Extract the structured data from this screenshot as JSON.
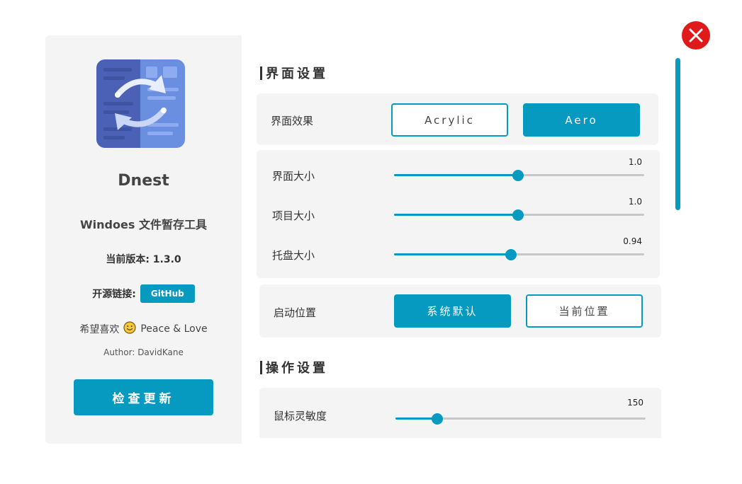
{
  "about": {
    "app_name": "Dnest",
    "subtitle": "Windoes 文件暂存工具",
    "version_line": "当前版本: 1.3.0",
    "source_label": "开源链接:",
    "github_label": "GitHub",
    "love_prefix": "希望喜欢",
    "love_suffix": "Peace & Love",
    "author": "Author: DavidKane",
    "update_button": "检查更新"
  },
  "sections": {
    "interface_title": "界面设置",
    "operation_title": "操作设置"
  },
  "interface": {
    "effect_label": "界面效果",
    "effect_options": [
      "Acrylic",
      "Aero"
    ],
    "effect_selected": "Aero",
    "sliders": [
      {
        "label": "界面大小",
        "value": "1.0",
        "fraction": 0.495
      },
      {
        "label": "项目大小",
        "value": "1.0",
        "fraction": 0.495
      },
      {
        "label": "托盘大小",
        "value": "0.94",
        "fraction": 0.467
      }
    ],
    "startup_label": "启动位置",
    "startup_options": [
      "系统默认",
      "当前位置"
    ],
    "startup_selected": "系统默认"
  },
  "operation": {
    "sensitivity_label": "鼠标灵敏度",
    "sensitivity_value": "150",
    "sensitivity_fraction": 0.167
  },
  "colors": {
    "accent": "#069ac0",
    "close": "#e01a1a",
    "panel": "#f4f4f4"
  }
}
